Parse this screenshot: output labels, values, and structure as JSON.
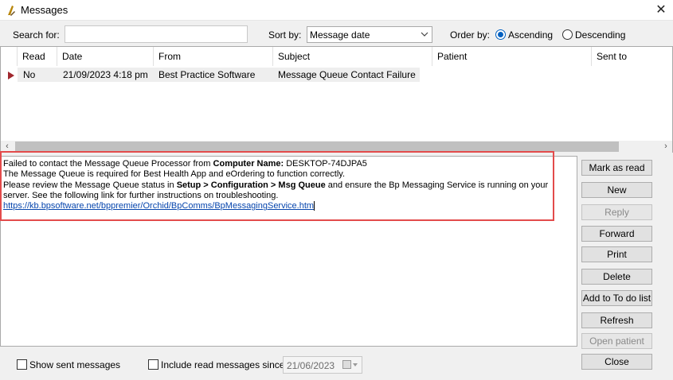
{
  "window": {
    "title": "Messages"
  },
  "toolbar": {
    "search_label": "Search for:",
    "search_value": "",
    "sort_label": "Sort by:",
    "sort_value": "Message date",
    "order_label": "Order by:",
    "order_ascending": "Ascending",
    "order_descending": "Descending",
    "order_selected": "Ascending"
  },
  "grid": {
    "columns": [
      "Read",
      "Date",
      "From",
      "Subject",
      "Patient",
      "Sent to"
    ],
    "rows": [
      {
        "read": "No",
        "date": "21/09/2023 4:18 pm",
        "from": "Best Practice Software",
        "subject": "Message Queue Contact Failure",
        "patient": "",
        "sent_to": ""
      }
    ]
  },
  "message": {
    "line1_pre": "Failed to contact the Message Queue Processor from ",
    "line1_bold": "Computer Name:",
    "line1_post": " DESKTOP-74DJPA5",
    "line2": "The Message Queue is required for Best Health App and eOrdering to function correctly.",
    "line3_pre": "Please review the Message Queue status in ",
    "line3_bold": "Setup > Configuration > Msg Queue",
    "line3_post": " and ensure the Bp Messaging Service is running on your",
    "line4": "server. See the following link for further instructions on troubleshooting.",
    "link": "https://kb.bpsoftware.net/bppremier/Orchid/BpComms/BpMessagingService.htm"
  },
  "buttons": {
    "mark_as_read": "Mark as read",
    "new": "New",
    "reply": "Reply",
    "forward": "Forward",
    "print": "Print",
    "delete": "Delete",
    "add_todo": "Add to To do list",
    "refresh": "Refresh",
    "open_patient": "Open patient",
    "close": "Close"
  },
  "footer": {
    "show_sent": "Show sent messages",
    "include_read": "Include read messages since",
    "date": "21/06/2023"
  },
  "colors": {
    "highlight_border": "#e34b4b",
    "row_marker": "#a0282e",
    "link": "#0645ad"
  }
}
